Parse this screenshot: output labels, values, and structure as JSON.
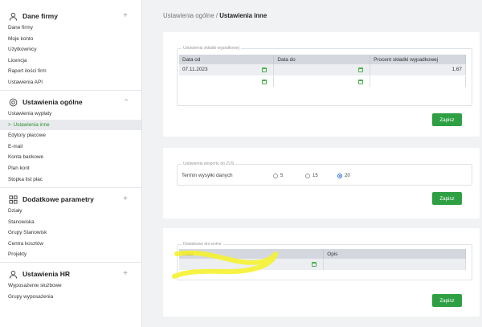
{
  "sidebar": {
    "sections": [
      {
        "title": "Dane firmy",
        "icon": "user-icon",
        "toggle": "+",
        "items": [
          "Dane firmy",
          "Moje konto",
          "Użytkownicy",
          "Licencja",
          "Raport ilości firm",
          "Ustawienia API"
        ]
      },
      {
        "title": "Ustawienia ogólne",
        "icon": "settings-icon",
        "toggle": "^",
        "items": [
          "Ustawienia wypłaty",
          "Ustawienia inne",
          "Edytory płacowe",
          "E-mail",
          "Konta bankowe",
          "Plan kont",
          "Stopka list płac"
        ],
        "active_index": 1
      },
      {
        "title": "Dodatkowe parametry",
        "icon": "grid-icon",
        "toggle": "+",
        "items": [
          "Działy",
          "Stanowiska",
          "Grupy Stanowisk",
          "Centra kosztów",
          "Projekty"
        ]
      },
      {
        "title": "Ustawienia HR",
        "icon": "user-icon",
        "toggle": "+",
        "items": [
          "Wyposażenie służbowe",
          "Grupy wyposażenia"
        ]
      }
    ]
  },
  "breadcrumb": {
    "parent": "Ustawienia ogólne",
    "separator": "/",
    "current": "Ustawienia inne"
  },
  "accident": {
    "legend": "Ustawienia składki wypadkowej",
    "headers": [
      "Data od",
      "Data do",
      "Procent składki wypadkowej"
    ],
    "rows": [
      [
        "07.11.2023",
        "",
        "1,67"
      ],
      [
        "",
        "",
        ""
      ]
    ],
    "save_label": "Zapisz"
  },
  "zus": {
    "legend": "Ustawienia eksportu do ZUS",
    "field_label": "Termin wysyłki danych",
    "options": [
      "5",
      "15",
      "20"
    ],
    "selected": "20",
    "save_label": "Zapisz"
  },
  "days_off": {
    "legend": "Dodatkowe dni wolne",
    "headers": [
      "Data",
      "Opis"
    ],
    "rows": [
      [
        "",
        ""
      ]
    ],
    "save_label": "Zapisz"
  },
  "colors": {
    "accent_green": "#2ea043",
    "active_green": "#2e8f2e",
    "highlight_yellow": "#f5f230"
  }
}
